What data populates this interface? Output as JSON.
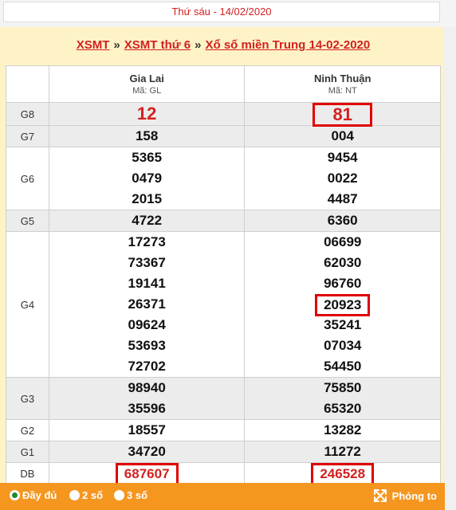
{
  "header": {
    "date_text": "Thứ sáu - 14/02/2020"
  },
  "title": {
    "link1": "XSMT",
    "sep1": "»",
    "link2": "XSMT thứ 6",
    "sep2": "»",
    "link3": "Xổ số miền Trung 14-02-2020"
  },
  "provinces": [
    {
      "name": "Gia Lai",
      "code": "Mã: GL"
    },
    {
      "name": "Ninh Thuận",
      "code": "Mã: NT"
    }
  ],
  "prizes": {
    "g8": {
      "label": "G8",
      "col1": [
        "12"
      ],
      "col2": [
        "81"
      ]
    },
    "g7": {
      "label": "G7",
      "col1": [
        "158"
      ],
      "col2": [
        "004"
      ]
    },
    "g6": {
      "label": "G6",
      "col1": [
        "5365",
        "0479",
        "2015"
      ],
      "col2": [
        "9454",
        "0022",
        "4487"
      ]
    },
    "g5": {
      "label": "G5",
      "col1": [
        "4722"
      ],
      "col2": [
        "6360"
      ]
    },
    "g4": {
      "label": "G4",
      "col1": [
        "17273",
        "73367",
        "19141",
        "26371",
        "09624",
        "53693",
        "72702"
      ],
      "col2": [
        "06699",
        "62030",
        "96760",
        "20923",
        "35241",
        "07034",
        "54450"
      ]
    },
    "g3": {
      "label": "G3",
      "col1": [
        "98940",
        "35596"
      ],
      "col2": [
        "75850",
        "65320"
      ]
    },
    "g2": {
      "label": "G2",
      "col1": [
        "18557"
      ],
      "col2": [
        "13282"
      ]
    },
    "g1": {
      "label": "G1",
      "col1": [
        "34720"
      ],
      "col2": [
        "11272"
      ]
    },
    "db": {
      "label": "DB",
      "col1": [
        "687607"
      ],
      "col2": [
        "246528"
      ]
    }
  },
  "footer": {
    "opt_full": "Đầy đủ",
    "opt_2": "2 số",
    "opt_3": "3 số",
    "zoom": "Phóng to",
    "selected": "Đầy đủ"
  },
  "colors": {
    "accent_red": "#d42020",
    "footer_orange": "#f5961f",
    "highlight_box": "#e00000"
  }
}
